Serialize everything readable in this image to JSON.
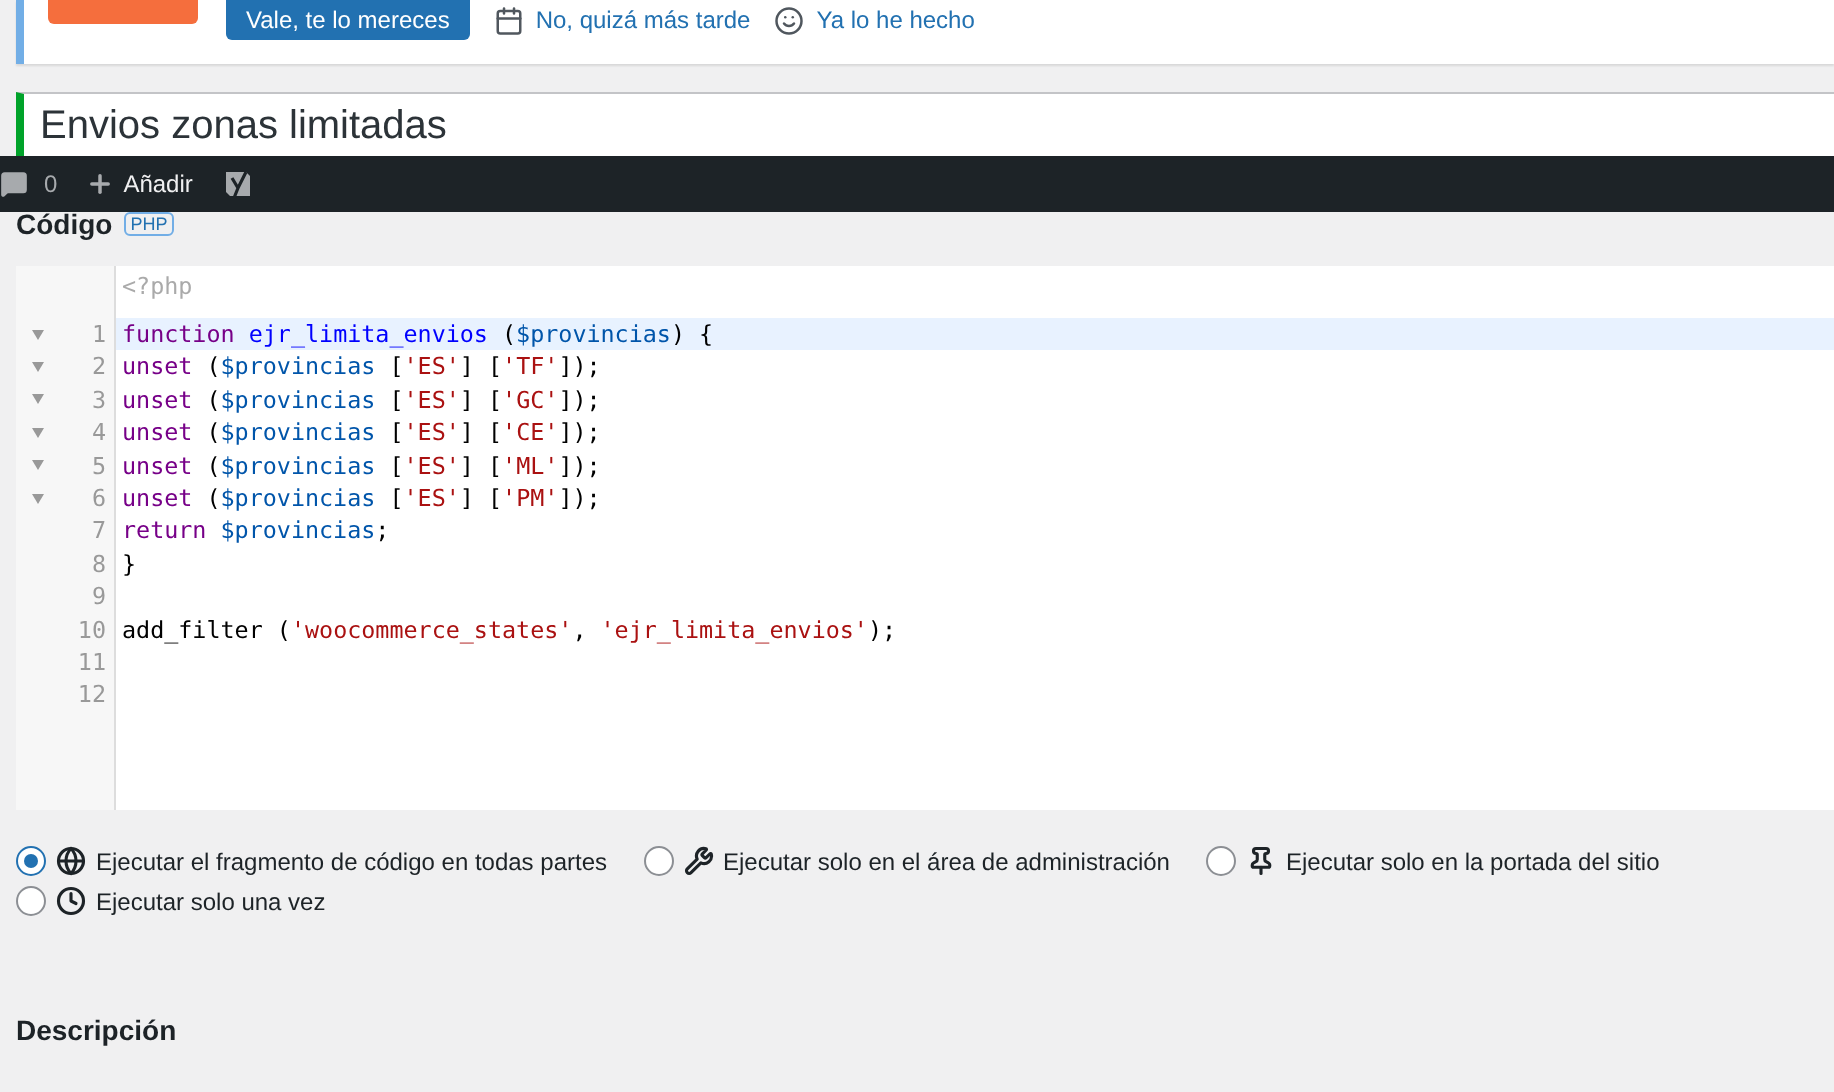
{
  "notice": {
    "buttons": [
      {
        "kind": "primary",
        "label": "Vale, te lo mereces"
      },
      {
        "kind": "later",
        "label": "No, quizá más tarde"
      },
      {
        "kind": "done",
        "label": "Ya lo he hecho"
      }
    ]
  },
  "title_field": {
    "value": "Envios zonas limitadas"
  },
  "admin_bar": {
    "comments": "0",
    "add": "Añadir"
  },
  "code_section": {
    "heading": "Código",
    "badge": "PHP",
    "header_line": "<?php",
    "lines": [
      {
        "number": "1",
        "fold": true,
        "active": true,
        "tokens": [
          {
            "kind": "keyword",
            "text": "function "
          },
          {
            "kind": "def",
            "text": "ejr_limita_envios"
          },
          {
            "kind": "plain",
            "text": " ("
          },
          {
            "kind": "variable",
            "text": "$provincias"
          },
          {
            "kind": "plain",
            "text": ") {"
          }
        ]
      },
      {
        "number": "2",
        "fold": true,
        "active": false,
        "tokens": [
          {
            "kind": "keyword",
            "text": "unset"
          },
          {
            "kind": "plain",
            "text": " ("
          },
          {
            "kind": "variable",
            "text": "$provincias"
          },
          {
            "kind": "plain",
            "text": " ["
          },
          {
            "kind": "string",
            "text": "'ES'"
          },
          {
            "kind": "plain",
            "text": "] ["
          },
          {
            "kind": "string",
            "text": "'TF'"
          },
          {
            "kind": "plain",
            "text": "]);"
          }
        ]
      },
      {
        "number": "3",
        "fold": true,
        "active": false,
        "tokens": [
          {
            "kind": "keyword",
            "text": "unset"
          },
          {
            "kind": "plain",
            "text": " ("
          },
          {
            "kind": "variable",
            "text": "$provincias"
          },
          {
            "kind": "plain",
            "text": " ["
          },
          {
            "kind": "string",
            "text": "'ES'"
          },
          {
            "kind": "plain",
            "text": "] ["
          },
          {
            "kind": "string",
            "text": "'GC'"
          },
          {
            "kind": "plain",
            "text": "]);"
          }
        ]
      },
      {
        "number": "4",
        "fold": true,
        "active": false,
        "tokens": [
          {
            "kind": "keyword",
            "text": "unset"
          },
          {
            "kind": "plain",
            "text": " ("
          },
          {
            "kind": "variable",
            "text": "$provincias"
          },
          {
            "kind": "plain",
            "text": " ["
          },
          {
            "kind": "string",
            "text": "'ES'"
          },
          {
            "kind": "plain",
            "text": "] ["
          },
          {
            "kind": "string",
            "text": "'CE'"
          },
          {
            "kind": "plain",
            "text": "]);"
          }
        ]
      },
      {
        "number": "5",
        "fold": true,
        "active": false,
        "tokens": [
          {
            "kind": "keyword",
            "text": "unset"
          },
          {
            "kind": "plain",
            "text": " ("
          },
          {
            "kind": "variable",
            "text": "$provincias"
          },
          {
            "kind": "plain",
            "text": " ["
          },
          {
            "kind": "string",
            "text": "'ES'"
          },
          {
            "kind": "plain",
            "text": "] ["
          },
          {
            "kind": "string",
            "text": "'ML'"
          },
          {
            "kind": "plain",
            "text": "]);"
          }
        ]
      },
      {
        "number": "6",
        "fold": true,
        "active": false,
        "tokens": [
          {
            "kind": "keyword",
            "text": "unset"
          },
          {
            "kind": "plain",
            "text": " ("
          },
          {
            "kind": "variable",
            "text": "$provincias"
          },
          {
            "kind": "plain",
            "text": " ["
          },
          {
            "kind": "string",
            "text": "'ES'"
          },
          {
            "kind": "plain",
            "text": "] ["
          },
          {
            "kind": "string",
            "text": "'PM'"
          },
          {
            "kind": "plain",
            "text": "]);"
          }
        ]
      },
      {
        "number": "7",
        "fold": false,
        "active": false,
        "tokens": [
          {
            "kind": "keyword",
            "text": "return "
          },
          {
            "kind": "variable",
            "text": "$provincias"
          },
          {
            "kind": "plain",
            "text": ";"
          }
        ]
      },
      {
        "number": "8",
        "fold": false,
        "active": false,
        "tokens": [
          {
            "kind": "plain",
            "text": "}"
          }
        ]
      },
      {
        "number": "9",
        "fold": false,
        "active": false
      },
      {
        "number": "10",
        "fold": false,
        "active": false,
        "tokens": [
          {
            "kind": "plain",
            "text": "add_filter ("
          },
          {
            "kind": "string",
            "text": "'woocommerce_states'"
          },
          {
            "kind": "plain",
            "text": ", "
          },
          {
            "kind": "string",
            "text": "'ejr_limita_envios'"
          },
          {
            "kind": "plain",
            "text": ");"
          }
        ]
      },
      {
        "number": "11",
        "fold": false,
        "active": false
      },
      {
        "number": "12",
        "fold": false,
        "active": false
      }
    ]
  },
  "scope_options": [
    {
      "kind": "everywhere",
      "label": "Ejecutar el fragmento de código en todas partes",
      "selected": true
    },
    {
      "kind": "admin",
      "label": "Ejecutar solo en el área de administración",
      "selected": false
    },
    {
      "kind": "frontend",
      "label": "Ejecutar solo en la portada del sitio",
      "selected": false
    },
    {
      "kind": "once",
      "label": "Ejecutar solo una vez",
      "selected": false
    }
  ],
  "description": {
    "heading": "Descripción"
  }
}
